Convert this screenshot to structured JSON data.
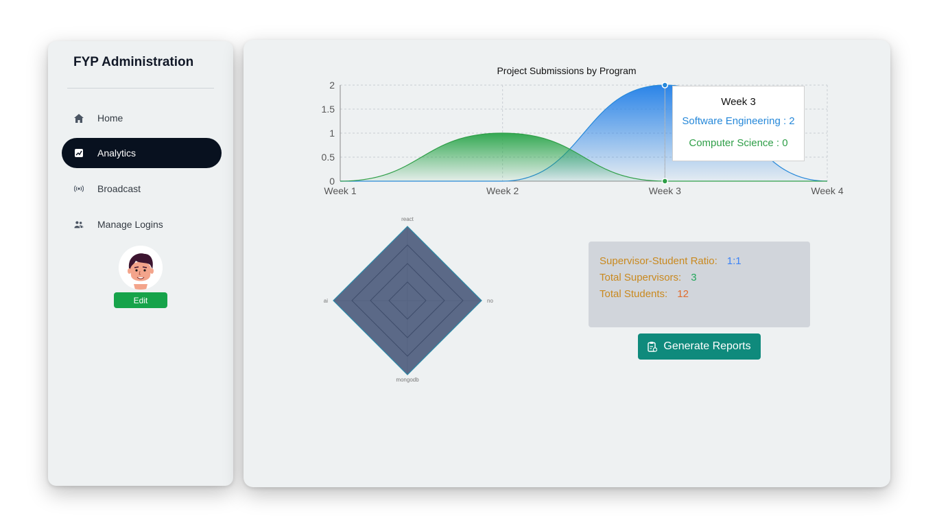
{
  "sidebar": {
    "title": "FYP Administration",
    "items": [
      {
        "label": "Home",
        "icon": "home-icon",
        "active": false
      },
      {
        "label": "Analytics",
        "icon": "analytics-icon",
        "active": true
      },
      {
        "label": "Broadcast",
        "icon": "broadcast-icon",
        "active": false
      },
      {
        "label": "Manage Logins",
        "icon": "users-icon",
        "active": false
      }
    ],
    "edit_label": "Edit"
  },
  "chart_data": [
    {
      "type": "area",
      "title": "Project Submissions by Program",
      "categories": [
        "Week 1",
        "Week 2",
        "Week 3",
        "Week 4"
      ],
      "ylim": [
        0,
        2
      ],
      "yticks": [
        "0",
        "0.5",
        "1",
        "1.5",
        "2"
      ],
      "grid": true,
      "series": [
        {
          "name": "Software Engineering",
          "values": [
            0,
            0,
            2,
            0
          ],
          "color": "#2688d9"
        },
        {
          "name": "Computer Science",
          "values": [
            0,
            1,
            0,
            0
          ],
          "color": "#2e9e47"
        }
      ],
      "tooltip": {
        "title": "Week 3",
        "lines": [
          "Software Engineering : 2",
          "Computer Science : 0"
        ]
      }
    },
    {
      "type": "radar",
      "axes": [
        "react",
        "no",
        "mongodb",
        "ai"
      ],
      "values": [
        1,
        1,
        1,
        1
      ],
      "fill_color": "#4a5a7b",
      "stroke_color": "#2a8aa8"
    }
  ],
  "stats": {
    "ratio_label": "Supervisor-Student Ratio:",
    "ratio_value": "1:1",
    "supervisors_label": "Total Supervisors:",
    "supervisors_value": "3",
    "students_label": "Total Students:",
    "students_value": "12",
    "colors": {
      "label": "#c9891f",
      "ratio": "#3b82f6",
      "supervisors": "#22a65a",
      "students": "#e06b2c"
    }
  },
  "actions": {
    "generate_reports_label": "Generate Reports"
  }
}
